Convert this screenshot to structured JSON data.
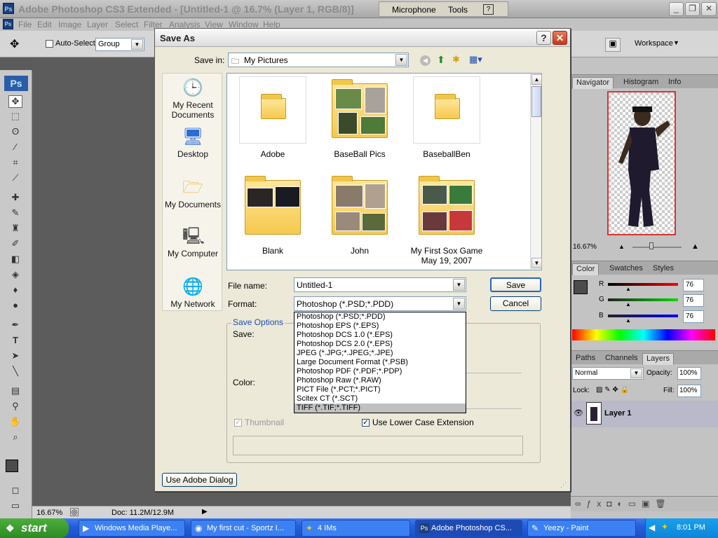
{
  "app": {
    "title": "Adobe Photoshop CS3 Extended - [Untitled-1 @ 16.7% (Layer 1, RGB/8)]",
    "langbar": {
      "microphone": "Microphone",
      "tools": "Tools"
    }
  },
  "menu": [
    "File",
    "Edit",
    "Image",
    "Layer",
    "Select",
    "Filter",
    "Analysis",
    "View",
    "Window",
    "Help"
  ],
  "options": {
    "auto_select_label": "Auto-Select:",
    "auto_select_value": "Group",
    "workspace": "Workspace"
  },
  "status": {
    "zoom": "16.67%",
    "doc": "Doc: 11.2M/12.9M"
  },
  "navigator": {
    "tabs": [
      "Navigator",
      "Histogram",
      "Info"
    ],
    "zoom": "16.67%"
  },
  "color_panel": {
    "tabs": [
      "Color",
      "Swatches",
      "Styles"
    ],
    "r_label": "R",
    "g_label": "G",
    "b_label": "B",
    "r": "76",
    "g": "76",
    "b": "76"
  },
  "layers_panel": {
    "tabs": [
      "Paths",
      "Channels",
      "Layers"
    ],
    "blend_mode": "Normal",
    "opacity_label": "Opacity:",
    "opacity": "100%",
    "lock_label": "Lock:",
    "fill_label": "Fill:",
    "fill": "100%",
    "layer_name": "Layer 1"
  },
  "dialog": {
    "title": "Save As",
    "save_in_label": "Save in:",
    "save_in_value": "My Pictures",
    "places": [
      "My Recent Documents",
      "Desktop",
      "My Documents",
      "My Computer",
      "My Network"
    ],
    "files": [
      "Adobe",
      "BaseBall Pics",
      "BaseballBen",
      "Blank",
      "John",
      "My First Sox Game May 19, 2007"
    ],
    "file_name_label": "File name:",
    "file_name_value": "Untitled-1",
    "format_label": "Format:",
    "format_value": "Photoshop (*.PSD;*.PDD)",
    "format_options": [
      "Photoshop (*.PSD;*.PDD)",
      "Photoshop EPS (*.EPS)",
      "Photoshop DCS 1.0 (*.EPS)",
      "Photoshop DCS 2.0 (*.EPS)",
      "JPEG (*.JPG;*.JPEG;*.JPE)",
      "Large Document Format (*.PSB)",
      "Photoshop PDF (*.PDF;*.PDP)",
      "Photoshop Raw (*.RAW)",
      "PICT File (*.PCT;*.PICT)",
      "Scitex CT (*.SCT)",
      "TIFF (*.TIF;*.TIFF)"
    ],
    "save_button": "Save",
    "cancel_button": "Cancel",
    "save_options_label": "Save Options",
    "save_label": "Save:",
    "color_label": "Color:",
    "thumbnail_label": "Thumbnail",
    "lowercase_label": "Use Lower Case Extension",
    "adobe_dialog_button": "Use Adobe Dialog"
  },
  "taskbar": {
    "start": "start",
    "tasks": [
      "Windows Media Playe...",
      "My first cut - Sportz I...",
      "4 IMs",
      "Adobe Photoshop CS...",
      "Yeezy - Paint"
    ],
    "clock": "8:01 PM"
  }
}
